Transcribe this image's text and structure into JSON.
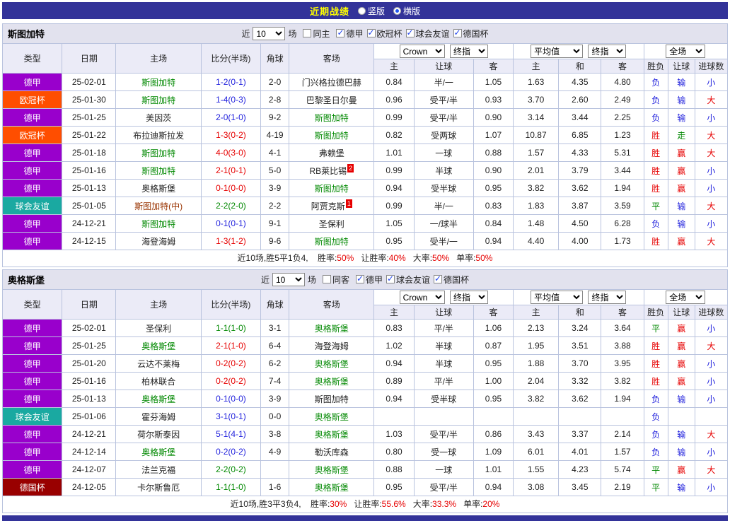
{
  "title_bar": {
    "title": "近期战绩",
    "view_modes": [
      {
        "label": "竖版",
        "selected": false
      },
      {
        "label": "横版",
        "selected": true
      }
    ]
  },
  "columns": {
    "type": "类型",
    "date": "日期",
    "home": "主场",
    "score": "比分(半场)",
    "corner": "角球",
    "away": "客场",
    "odds_home": "主",
    "odds_handicap": "让球",
    "odds_away": "客",
    "avg_home": "主",
    "avg_draw": "和",
    "avg_away": "客",
    "result": "胜负",
    "handicap_result": "让球",
    "goals": "进球数"
  },
  "colors": {
    "titlebar_bg": "#333399",
    "header_bg": "#e2e2ee",
    "league": {
      "德甲": "#9900cc",
      "欧冠杯": "#ff4e00",
      "球会友谊": "#1aa9a1",
      "德国杯": "#990000"
    },
    "value": {
      "red": "#e60000",
      "green": "#008800",
      "blue": "#2222dd",
      "black": "#222222"
    },
    "team": {
      "green": "#008800",
      "black": "#222222",
      "maroon": "#993300"
    }
  },
  "sections": [
    {
      "team": "斯图加特",
      "filters": {
        "recent_label": "近",
        "recent_value": "10",
        "unit_label": "场",
        "same_home": {
          "label": "同主",
          "checked": false
        },
        "leagues": [
          {
            "label": "德甲",
            "checked": true
          },
          {
            "label": "欧冠杯",
            "checked": true
          },
          {
            "label": "球会友谊",
            "checked": true
          },
          {
            "label": "德国杯",
            "checked": true
          }
        ]
      },
      "selects": {
        "bookmaker": "Crown",
        "odds_stage": "终指",
        "average": "平均值",
        "average_stage": "终指",
        "scope": "全场"
      },
      "rows": [
        {
          "league": "德甲",
          "date": "25-02-01",
          "home": "斯图加特",
          "home_color": "green",
          "score": "1-2(0-1)",
          "score_color": "blue",
          "corner": "2-0",
          "away": "门兴格拉德巴赫",
          "away_color": "black",
          "away_sup": "",
          "odds": [
            "0.84",
            "半/一",
            "1.05"
          ],
          "avg": [
            "1.63",
            "4.35",
            "4.80"
          ],
          "result": "负",
          "result_color": "blue",
          "hcp": "输",
          "hcp_color": "blue",
          "goal": "小",
          "goal_color": "blue"
        },
        {
          "league": "欧冠杯",
          "date": "25-01-30",
          "home": "斯图加特",
          "home_color": "green",
          "score": "1-4(0-3)",
          "score_color": "blue",
          "corner": "2-8",
          "away": "巴黎圣日尔曼",
          "away_color": "black",
          "away_sup": "",
          "odds": [
            "0.96",
            "受平/半",
            "0.93"
          ],
          "avg": [
            "3.70",
            "2.60",
            "2.49"
          ],
          "result": "负",
          "result_color": "blue",
          "hcp": "输",
          "hcp_color": "blue",
          "goal": "大",
          "goal_color": "red"
        },
        {
          "league": "德甲",
          "date": "25-01-25",
          "home": "美因茨",
          "home_color": "black",
          "score": "2-0(1-0)",
          "score_color": "blue",
          "corner": "9-2",
          "away": "斯图加特",
          "away_color": "green",
          "away_sup": "",
          "odds": [
            "0.99",
            "受平/半",
            "0.90"
          ],
          "avg": [
            "3.14",
            "3.44",
            "2.25"
          ],
          "result": "负",
          "result_color": "blue",
          "hcp": "输",
          "hcp_color": "blue",
          "goal": "小",
          "goal_color": "blue"
        },
        {
          "league": "欧冠杯",
          "date": "25-01-22",
          "home": "布拉迪斯拉发",
          "home_color": "black",
          "score": "1-3(0-2)",
          "score_color": "red",
          "corner": "4-19",
          "away": "斯图加特",
          "away_color": "green",
          "away_sup": "",
          "odds": [
            "0.82",
            "受两球",
            "1.07"
          ],
          "avg": [
            "10.87",
            "6.85",
            "1.23"
          ],
          "result": "胜",
          "result_color": "red",
          "hcp": "走",
          "hcp_color": "green",
          "goal": "大",
          "goal_color": "red"
        },
        {
          "league": "德甲",
          "date": "25-01-18",
          "home": "斯图加特",
          "home_color": "green",
          "score": "4-0(3-0)",
          "score_color": "red",
          "corner": "4-1",
          "away": "弗赖堡",
          "away_color": "black",
          "away_sup": "",
          "odds": [
            "1.01",
            "一球",
            "0.88"
          ],
          "avg": [
            "1.57",
            "4.33",
            "5.31"
          ],
          "result": "胜",
          "result_color": "red",
          "hcp": "赢",
          "hcp_color": "red",
          "goal": "大",
          "goal_color": "red"
        },
        {
          "league": "德甲",
          "date": "25-01-16",
          "home": "斯图加特",
          "home_color": "green",
          "score": "2-1(0-1)",
          "score_color": "red",
          "corner": "5-0",
          "away": "RB莱比锡",
          "away_color": "black",
          "away_sup": "2",
          "odds": [
            "0.99",
            "半球",
            "0.90"
          ],
          "avg": [
            "2.01",
            "3.79",
            "3.44"
          ],
          "result": "胜",
          "result_color": "red",
          "hcp": "赢",
          "hcp_color": "red",
          "goal": "小",
          "goal_color": "blue"
        },
        {
          "league": "德甲",
          "date": "25-01-13",
          "home": "奥格斯堡",
          "home_color": "black",
          "score": "0-1(0-0)",
          "score_color": "red",
          "corner": "3-9",
          "away": "斯图加特",
          "away_color": "green",
          "away_sup": "",
          "odds": [
            "0.94",
            "受半球",
            "0.95"
          ],
          "avg": [
            "3.82",
            "3.62",
            "1.94"
          ],
          "result": "胜",
          "result_color": "red",
          "hcp": "赢",
          "hcp_color": "red",
          "goal": "小",
          "goal_color": "blue"
        },
        {
          "league": "球会友谊",
          "date": "25-01-05",
          "home": "斯图加特(中)",
          "home_color": "maroon",
          "score": "2-2(2-0)",
          "score_color": "green",
          "corner": "2-2",
          "away": "阿贾克斯",
          "away_color": "black",
          "away_sup": "1",
          "odds": [
            "0.99",
            "半/一",
            "0.83"
          ],
          "avg": [
            "1.83",
            "3.87",
            "3.59"
          ],
          "result": "平",
          "result_color": "green",
          "hcp": "输",
          "hcp_color": "blue",
          "goal": "大",
          "goal_color": "red"
        },
        {
          "league": "德甲",
          "date": "24-12-21",
          "home": "斯图加特",
          "home_color": "green",
          "score": "0-1(0-1)",
          "score_color": "blue",
          "corner": "9-1",
          "away": "圣保利",
          "away_color": "black",
          "away_sup": "",
          "odds": [
            "1.05",
            "一/球半",
            "0.84"
          ],
          "avg": [
            "1.48",
            "4.50",
            "6.28"
          ],
          "result": "负",
          "result_color": "blue",
          "hcp": "输",
          "hcp_color": "blue",
          "goal": "小",
          "goal_color": "blue"
        },
        {
          "league": "德甲",
          "date": "24-12-15",
          "home": "海登海姆",
          "home_color": "black",
          "score": "1-3(1-2)",
          "score_color": "red",
          "corner": "9-6",
          "away": "斯图加特",
          "away_color": "green",
          "away_sup": "",
          "odds": [
            "0.95",
            "受半/一",
            "0.94"
          ],
          "avg": [
            "4.40",
            "4.00",
            "1.73"
          ],
          "result": "胜",
          "result_color": "red",
          "hcp": "赢",
          "hcp_color": "red",
          "goal": "大",
          "goal_color": "red"
        }
      ],
      "summary": {
        "prefix": "近10场,胜5平1负4,",
        "stats": [
          {
            "label": "胜率:",
            "value": "50%"
          },
          {
            "label": "让胜率:",
            "value": "40%"
          },
          {
            "label": "大率:",
            "value": "50%"
          },
          {
            "label": "单率:",
            "value": "50%"
          }
        ]
      }
    },
    {
      "team": "奥格斯堡",
      "filters": {
        "recent_label": "近",
        "recent_value": "10",
        "unit_label": "场",
        "same_home": {
          "label": "同客",
          "checked": false
        },
        "leagues": [
          {
            "label": "德甲",
            "checked": true
          },
          {
            "label": "球会友谊",
            "checked": true
          },
          {
            "label": "德国杯",
            "checked": true
          }
        ]
      },
      "selects": {
        "bookmaker": "Crown",
        "odds_stage": "终指",
        "average": "平均值",
        "average_stage": "终指",
        "scope": "全场"
      },
      "rows": [
        {
          "league": "德甲",
          "date": "25-02-01",
          "home": "圣保利",
          "home_color": "black",
          "score": "1-1(1-0)",
          "score_color": "green",
          "corner": "3-1",
          "away": "奥格斯堡",
          "away_color": "green",
          "away_sup": "",
          "odds": [
            "0.83",
            "平/半",
            "1.06"
          ],
          "avg": [
            "2.13",
            "3.24",
            "3.64"
          ],
          "result": "平",
          "result_color": "green",
          "hcp": "赢",
          "hcp_color": "red",
          "goal": "小",
          "goal_color": "blue"
        },
        {
          "league": "德甲",
          "date": "25-01-25",
          "home": "奥格斯堡",
          "home_color": "green",
          "score": "2-1(1-0)",
          "score_color": "red",
          "corner": "6-4",
          "away": "海登海姆",
          "away_color": "black",
          "away_sup": "",
          "odds": [
            "1.02",
            "半球",
            "0.87"
          ],
          "avg": [
            "1.95",
            "3.51",
            "3.88"
          ],
          "result": "胜",
          "result_color": "red",
          "hcp": "赢",
          "hcp_color": "red",
          "goal": "大",
          "goal_color": "red"
        },
        {
          "league": "德甲",
          "date": "25-01-20",
          "home": "云达不莱梅",
          "home_color": "black",
          "score": "0-2(0-2)",
          "score_color": "red",
          "corner": "6-2",
          "away": "奥格斯堡",
          "away_color": "green",
          "away_sup": "",
          "odds": [
            "0.94",
            "半球",
            "0.95"
          ],
          "avg": [
            "1.88",
            "3.70",
            "3.95"
          ],
          "result": "胜",
          "result_color": "red",
          "hcp": "赢",
          "hcp_color": "red",
          "goal": "小",
          "goal_color": "blue"
        },
        {
          "league": "德甲",
          "date": "25-01-16",
          "home": "柏林联合",
          "home_color": "black",
          "score": "0-2(0-2)",
          "score_color": "red",
          "corner": "7-4",
          "away": "奥格斯堡",
          "away_color": "green",
          "away_sup": "",
          "odds": [
            "0.89",
            "平/半",
            "1.00"
          ],
          "avg": [
            "2.04",
            "3.32",
            "3.82"
          ],
          "result": "胜",
          "result_color": "red",
          "hcp": "赢",
          "hcp_color": "red",
          "goal": "小",
          "goal_color": "blue"
        },
        {
          "league": "德甲",
          "date": "25-01-13",
          "home": "奥格斯堡",
          "home_color": "green",
          "score": "0-1(0-0)",
          "score_color": "blue",
          "corner": "3-9",
          "away": "斯图加特",
          "away_color": "black",
          "away_sup": "",
          "odds": [
            "0.94",
            "受半球",
            "0.95"
          ],
          "avg": [
            "3.82",
            "3.62",
            "1.94"
          ],
          "result": "负",
          "result_color": "blue",
          "hcp": "输",
          "hcp_color": "blue",
          "goal": "小",
          "goal_color": "blue"
        },
        {
          "league": "球会友谊",
          "date": "25-01-06",
          "home": "霍芬海姆",
          "home_color": "black",
          "score": "3-1(0-1)",
          "score_color": "blue",
          "corner": "0-0",
          "away": "奥格斯堡",
          "away_color": "green",
          "away_sup": "",
          "odds": [
            "",
            "",
            ""
          ],
          "avg": [
            "",
            "",
            ""
          ],
          "result": "负",
          "result_color": "blue",
          "hcp": "",
          "hcp_color": "black",
          "goal": "",
          "goal_color": "black"
        },
        {
          "league": "德甲",
          "date": "24-12-21",
          "home": "荷尔斯泰因",
          "home_color": "black",
          "score": "5-1(4-1)",
          "score_color": "blue",
          "corner": "3-8",
          "away": "奥格斯堡",
          "away_color": "green",
          "away_sup": "",
          "odds": [
            "1.03",
            "受平/半",
            "0.86"
          ],
          "avg": [
            "3.43",
            "3.37",
            "2.14"
          ],
          "result": "负",
          "result_color": "blue",
          "hcp": "输",
          "hcp_color": "blue",
          "goal": "大",
          "goal_color": "red"
        },
        {
          "league": "德甲",
          "date": "24-12-14",
          "home": "奥格斯堡",
          "home_color": "green",
          "score": "0-2(0-2)",
          "score_color": "blue",
          "corner": "4-9",
          "away": "勒沃库森",
          "away_color": "black",
          "away_sup": "",
          "odds": [
            "0.80",
            "受一球",
            "1.09"
          ],
          "avg": [
            "6.01",
            "4.01",
            "1.57"
          ],
          "result": "负",
          "result_color": "blue",
          "hcp": "输",
          "hcp_color": "blue",
          "goal": "小",
          "goal_color": "blue"
        },
        {
          "league": "德甲",
          "date": "24-12-07",
          "home": "法兰克福",
          "home_color": "black",
          "score": "2-2(0-2)",
          "score_color": "green",
          "corner": "",
          "away": "奥格斯堡",
          "away_color": "green",
          "away_sup": "",
          "odds": [
            "0.88",
            "一球",
            "1.01"
          ],
          "avg": [
            "1.55",
            "4.23",
            "5.74"
          ],
          "result": "平",
          "result_color": "green",
          "hcp": "赢",
          "hcp_color": "red",
          "goal": "大",
          "goal_color": "red"
        },
        {
          "league": "德国杯",
          "date": "24-12-05",
          "home": "卡尔斯鲁厄",
          "home_color": "black",
          "score": "1-1(1-0)",
          "score_color": "green",
          "corner": "1-6",
          "away": "奥格斯堡",
          "away_color": "green",
          "away_sup": "",
          "odds": [
            "0.95",
            "受平/半",
            "0.94"
          ],
          "avg": [
            "3.08",
            "3.45",
            "2.19"
          ],
          "result": "平",
          "result_color": "green",
          "hcp": "输",
          "hcp_color": "blue",
          "goal": "小",
          "goal_color": "blue"
        }
      ],
      "summary": {
        "prefix": "近10场,胜3平3负4,",
        "stats": [
          {
            "label": "胜率:",
            "value": "30%"
          },
          {
            "label": "让胜率:",
            "value": "55.6%"
          },
          {
            "label": "大率:",
            "value": "33.3%"
          },
          {
            "label": "单率:",
            "value": "20%"
          }
        ]
      }
    }
  ]
}
